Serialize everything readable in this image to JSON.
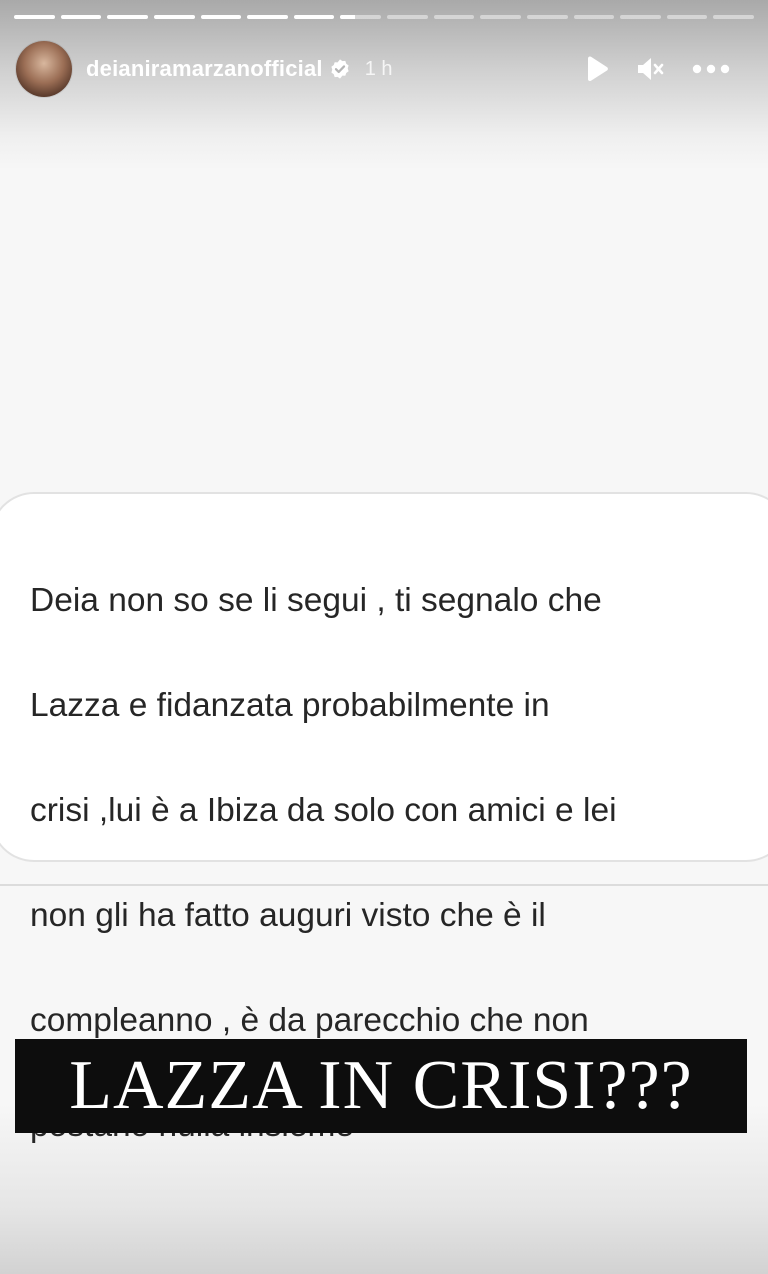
{
  "story": {
    "segments": [
      1,
      1,
      1,
      1,
      1,
      1,
      1,
      0.35,
      0,
      0,
      0,
      0,
      0,
      0,
      0,
      0
    ],
    "username": "deianiramarzanofficial",
    "time": "1 h",
    "icons": {
      "avatar": "profile-photo",
      "verified": "verified-badge-icon",
      "play": "play-icon",
      "mute": "speaker-muted-icon",
      "more": "more-options-icon"
    }
  },
  "message": {
    "lines": [
      "Deia non so se li segui , ti segnalo che",
      "Lazza e fidanzata probabilmente in",
      "crisi ,lui è a Ibiza da solo con amici e lei",
      "non gli ha fatto auguri visto che è il",
      "compleanno , è da parecchio che non",
      "postano nulla insieme"
    ]
  },
  "banner": {
    "text": "LAZZA IN CRISI???"
  },
  "colors": {
    "banner_bg": "#0d0d0d",
    "banner_text": "#ffffff",
    "message_text": "#262626"
  }
}
